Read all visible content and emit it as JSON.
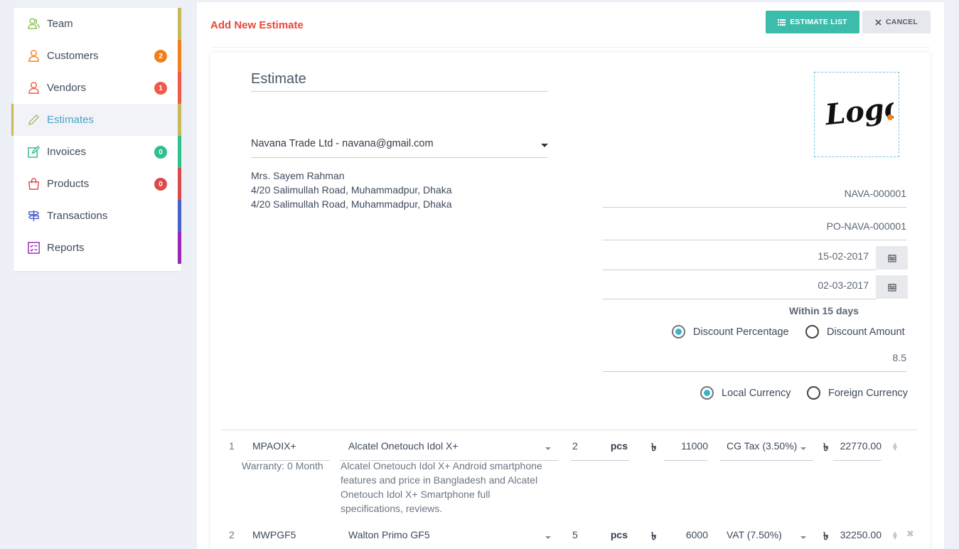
{
  "sidebar": {
    "items": [
      {
        "label": "Team",
        "icon": "team-icon",
        "icon_color": "#8cc152",
        "bar_color": "#c9b95a",
        "badge": null,
        "badge_color": null
      },
      {
        "label": "Customers",
        "icon": "customers-icon",
        "icon_color": "#f58220",
        "bar_color": "#f0801d",
        "badge": "2",
        "badge_color": "#f0801d"
      },
      {
        "label": "Vendors",
        "icon": "vendors-icon",
        "icon_color": "#ef5b4b",
        "bar_color": "#ef5b4b",
        "badge": "1",
        "badge_color": "#ef5b4b"
      },
      {
        "label": "Estimates",
        "icon": "pencil-icon",
        "icon_color": "#a5c35b",
        "bar_color": "#c9b95a",
        "badge": null,
        "badge_color": null
      },
      {
        "label": "Invoices",
        "icon": "invoice-edit-icon",
        "icon_color": "#2fc08c",
        "bar_color": "#2fc08c",
        "badge": "0",
        "badge_color": "#2fc08c"
      },
      {
        "label": "Products",
        "icon": "shopping-bag-icon",
        "icon_color": "#dd4a4a",
        "bar_color": "#dd4a4a",
        "badge": "0",
        "badge_color": "#dd4a4a"
      },
      {
        "label": "Transactions",
        "icon": "signpost-icon",
        "icon_color": "#4a60c9",
        "bar_color": "#4a60c9",
        "badge": null,
        "badge_color": null
      },
      {
        "label": "Reports",
        "icon": "report-list-icon",
        "icon_color": "#9b28b4",
        "bar_color": "#9b28b4",
        "badge": null,
        "badge_color": null
      }
    ],
    "active_index": 3
  },
  "header": {
    "title": "Add New Estimate",
    "estimate_list_label": "ESTIMATE LIST",
    "cancel_label": "CANCEL"
  },
  "form": {
    "heading": "Estimate",
    "customer": "Navana Trade Ltd - navana@gmail.com",
    "address_lines": [
      "Mrs. Sayem Rahman",
      "4/20 Salimullah Road, Muhammadpur, Dhaka",
      "4/20 Salimullah Road, Muhammadpur, Dhaka"
    ],
    "logo_text": "Logo.",
    "estimate_number": "NAVA-000001",
    "po_number": "PO-NAVA-000001",
    "estimate_date": "15-02-2017",
    "expiry_date": "02-03-2017",
    "within_text": "Within 15 days",
    "discount_percentage_label": "Discount Percentage",
    "discount_amount_label": "Discount Amount",
    "discount_value": "8.5",
    "local_currency_label": "Local Currency",
    "foreign_currency_label": "Foreign Currency"
  },
  "items": [
    {
      "index": "1",
      "code": "MPAOIX+",
      "warranty": "Warranty: 0 Month",
      "name": "Alcatel Onetouch Idol X+",
      "description": [
        "Alcatel Onetouch Idol X+ Android smartphone",
        "features and price in Bangladesh and Alcatel",
        "Onetouch Idol X+ Smartphone full",
        "specifications, reviews."
      ],
      "qty": "2",
      "unit": "pcs",
      "currency_symbol": "৳",
      "price": "11000",
      "tax": "CG Tax (3.50%)",
      "total": "22770.00"
    },
    {
      "index": "2",
      "code": "MWPGF5",
      "warranty": "",
      "name": "Walton Primo GF5",
      "description": [],
      "qty": "5",
      "unit": "pcs",
      "currency_symbol": "৳",
      "price": "6000",
      "tax": "VAT (7.50%)",
      "total": "32250.00"
    }
  ]
}
